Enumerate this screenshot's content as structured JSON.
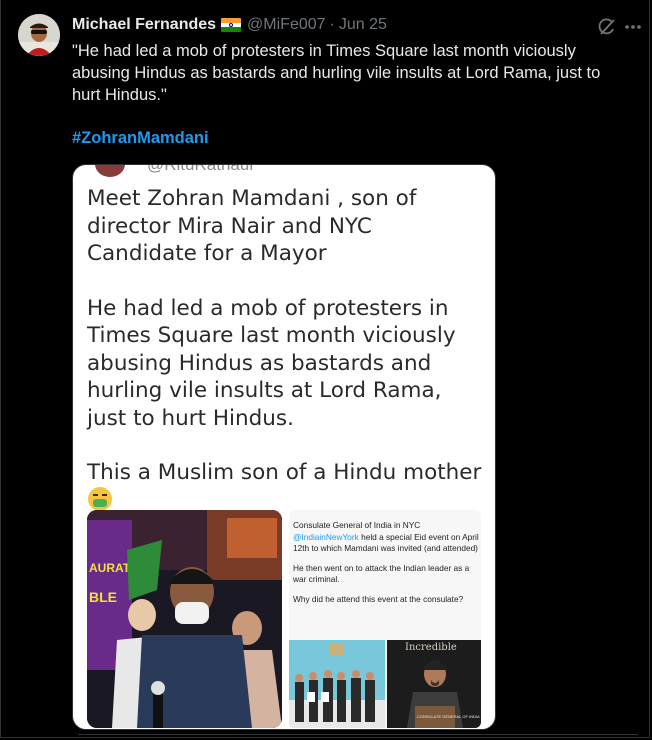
{
  "tweet": {
    "author_name": "Michael Fernandes",
    "flag_icon": "india-flag-icon",
    "handle": "@MiFe007",
    "separator": "·",
    "date": "Jun 25",
    "text": "\"He had led a mob of protesters in Times Square last month viciously abusing Hindus as bastards and hurling vile insults at Lord Rama, just to hurt Hindus.\"",
    "hashtag": "#ZohranMamdani",
    "actions": {
      "grok_icon": "grok-icon",
      "more_icon": "more-icon"
    }
  },
  "embedded": {
    "handle": "@RituRathaur",
    "paragraph1": "Meet Zohran Mamdani , son of director Mira Nair and NYC Candidate for a Mayor",
    "paragraph2": "He had led a mob of protesters in Times Square last month viciously abusing Hindus as bastards and hurling vile insults at Lord Rama, just to hurt Hindus.",
    "paragraph3": "This a Muslim son of a Hindu mother",
    "emoji_icon": "nauseated-face-icon",
    "video": {
      "banner_text_1": "AURAT",
      "banner_text_2": "BLE"
    },
    "consulate_post": {
      "line1_prefix": "Consulate General of India in NYC",
      "mention": "@IndiainNewYork",
      "line1_suffix": "held a special Eid event on April 12th to which Mamdani was invited (and attended)",
      "line2": "He then went on to attack the Indian leader as a war criminal.",
      "line3": "Why did he attend this event at the consulate?",
      "photo_caption": "Incredible",
      "podium_text": "CONSULATE GENERAL OF INDIA"
    }
  },
  "colors": {
    "background": "#000000",
    "text": "#e7e9ea",
    "muted": "#71767b",
    "link": "#1d9bf0"
  }
}
